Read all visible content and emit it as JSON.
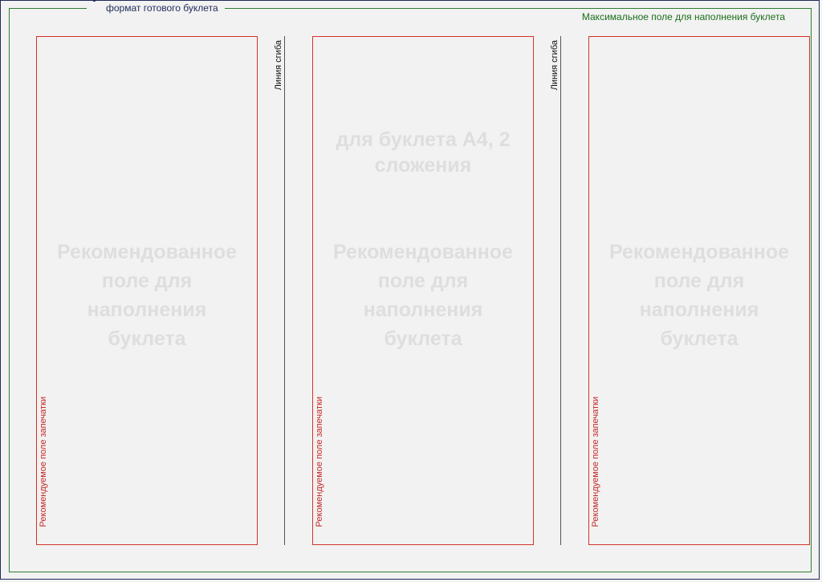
{
  "labels": {
    "format": "формат готового буклета",
    "max_area": "Максимальное поле для наполнения буклета",
    "fold_line": "Линия сгиба",
    "print_area": "Рекомендуемое поле запечатки"
  },
  "panels": [
    {
      "caption": "Рекомендованное поле для наполнения буклета"
    },
    {
      "top_caption": "для буклета А4, 2 сложения",
      "caption": "Рекомендованное поле для наполнения буклета"
    },
    {
      "caption": "Рекомендованное поле для наполнения буклета"
    }
  ],
  "colors": {
    "trim": "#1e2a5a",
    "safe": "#2e7d32",
    "panel": "#d2342a",
    "fold": "#555555",
    "watermark": "#dedede"
  }
}
